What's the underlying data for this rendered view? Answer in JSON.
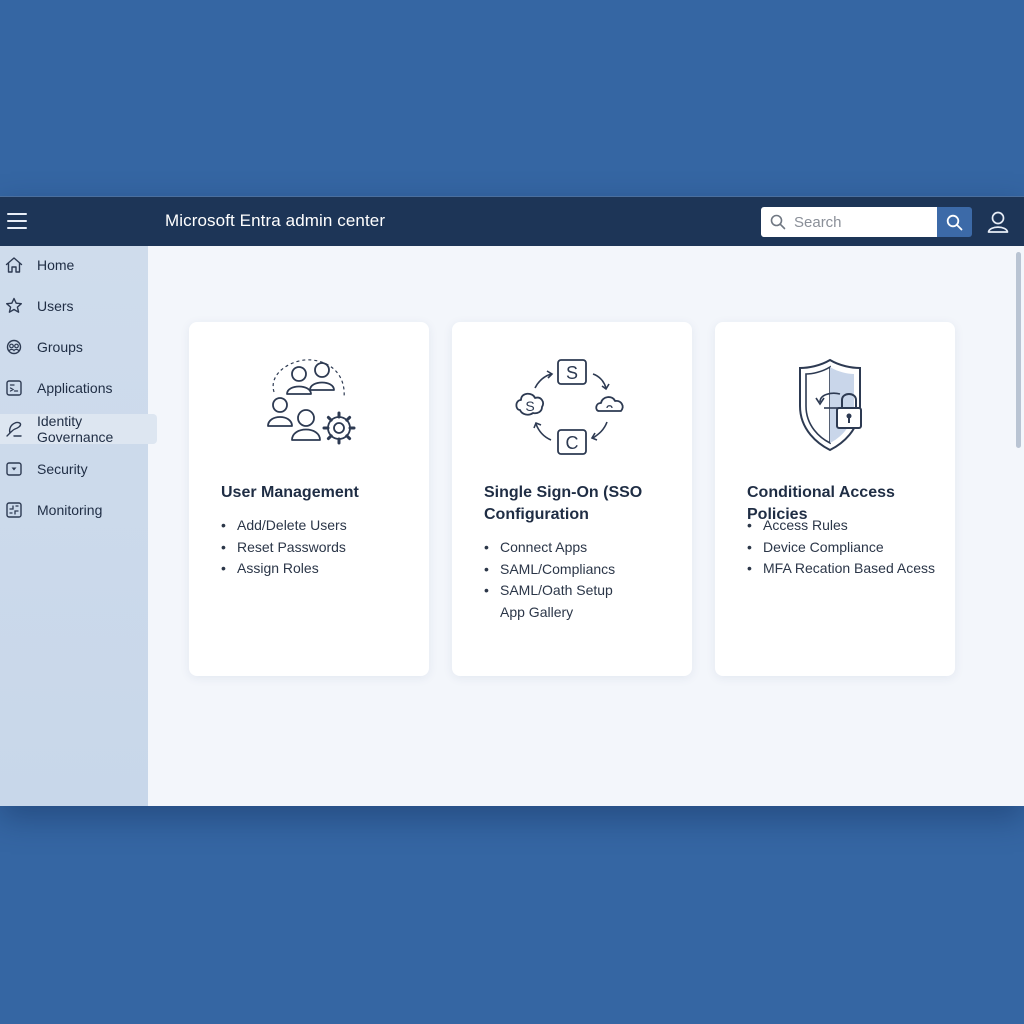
{
  "header": {
    "title": "Microsoft Entra admin center",
    "search_placeholder": "Search"
  },
  "sidebar": {
    "items": [
      {
        "label": "Home",
        "icon": "home-icon"
      },
      {
        "label": "Users",
        "icon": "users-icon"
      },
      {
        "label": "Groups",
        "icon": "groups-icon"
      },
      {
        "label": "Applications",
        "icon": "applications-icon"
      },
      {
        "label": "Identity Governance",
        "icon": "identity-governance-icon"
      },
      {
        "label": "Security",
        "icon": "security-icon"
      },
      {
        "label": "Monitoring",
        "icon": "monitoring-icon"
      }
    ],
    "active_index": 4
  },
  "cards": [
    {
      "title": "User Management",
      "icon": "user-management-icon",
      "items": [
        "Add/Delete Users",
        "Reset Passwords",
        "Assign Roles"
      ]
    },
    {
      "title_line1": "Single Sign-On (SSO",
      "title_line2": "Configuration",
      "icon": "sso-cycle-icon",
      "items": [
        "Connect Apps",
        "SAML/Compliancs",
        "SAML/Oath Setup",
        "App Gallery"
      ]
    },
    {
      "title": "Conditional Access Policies",
      "icon": "shield-lock-icon",
      "items": [
        "Access Rules",
        "Device Compliance",
        "MFA Recation Based Acess"
      ]
    }
  ],
  "colors": {
    "background": "#3566a3",
    "topbar": "#1d3557",
    "sidebar": "#cfdcec",
    "accent": "#3c6aa8"
  }
}
